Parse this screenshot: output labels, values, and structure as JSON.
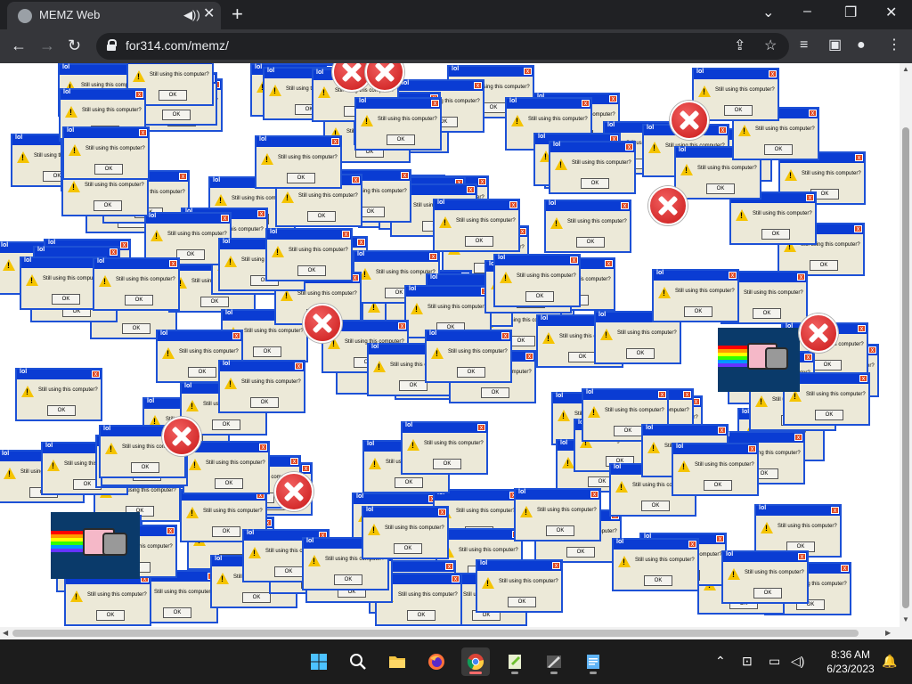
{
  "browser": {
    "tab": {
      "title": "MEMZ Web",
      "audio_icon": "speaker-icon",
      "close_icon": "close-icon"
    },
    "new_tab_label": "+",
    "window_controls": {
      "tabs_menu": "⌄",
      "minimize": "–",
      "restore": "❐",
      "close": "✕"
    },
    "toolbar": {
      "back": "←",
      "forward": "→",
      "reload": "↻",
      "url": "for314.com/memz/",
      "share": "⇪",
      "bookmark": "☆",
      "media": "≡",
      "sidepanel": "▣",
      "profile": "●",
      "menu": "⋮"
    }
  },
  "page": {
    "dialog": {
      "title": "lol",
      "message": "Still using this computer?",
      "ok_label": "OK",
      "close_label": "x",
      "icon": "warning-icon"
    },
    "error_icon": "error-x-icon",
    "nyan_cat": "nyan-cat-image"
  },
  "taskbar": {
    "apps": [
      "start",
      "search",
      "file-explorer",
      "firefox",
      "chrome",
      "notepad-plus",
      "app-7",
      "notepad"
    ],
    "tray": {
      "chevron": "⌃",
      "network": "⊡",
      "volume": "🔊",
      "speaker": "◁)",
      "notifications": "🔔"
    },
    "time": "8:36 AM",
    "date": "6/23/2023"
  },
  "colors": {
    "chrome_dark": "#202124",
    "xp_title_blue": "#0a3cd3",
    "xp_dialog_bg": "#ece9d8",
    "error_red": "#d62020"
  }
}
